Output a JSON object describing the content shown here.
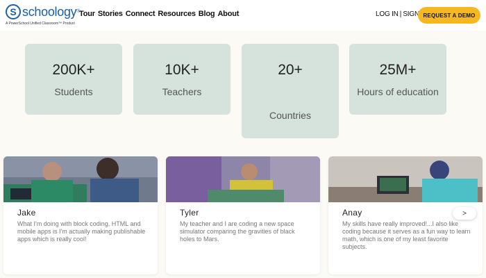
{
  "header": {
    "logo_letter": "S",
    "logo_word": "schoology",
    "logo_tm": "®",
    "tagline": "A PowerSchool Unified Classroom™ Product",
    "nav": [
      "Tour",
      "Stories",
      "Connect",
      "Resources",
      "Blog",
      "About"
    ],
    "login": "LOG IN",
    "separator": "|",
    "signup": "SIGN UP",
    "cta": "REQUEST A DEMO"
  },
  "stats": [
    {
      "value": "200K+",
      "label": "Students"
    },
    {
      "value": "10K+",
      "label": "Teachers"
    },
    {
      "value": "20+",
      "label": "Countries"
    },
    {
      "value": "25M+",
      "label": "Hours of education"
    }
  ],
  "stories": [
    {
      "name": "Jake",
      "quote": "What I'm doing with block coding, HTML and mobile apps is I'm actually making publishable apps which is really cool!"
    },
    {
      "name": "Tyler",
      "quote": "My teacher and I are coding a new space simulator comparing the gravities of black holes to Mars."
    },
    {
      "name": "Anay",
      "quote": "My skills have really improved!...I also like coding because it serves as a fun way to learn math, which is one of my least favorite subjects."
    }
  ],
  "carousel": {
    "next_icon": "chevron-right-icon"
  },
  "colors": {
    "accent": "#f5b820",
    "stat_bg": "#d6e3dd",
    "brand": "#1b5fa8"
  }
}
